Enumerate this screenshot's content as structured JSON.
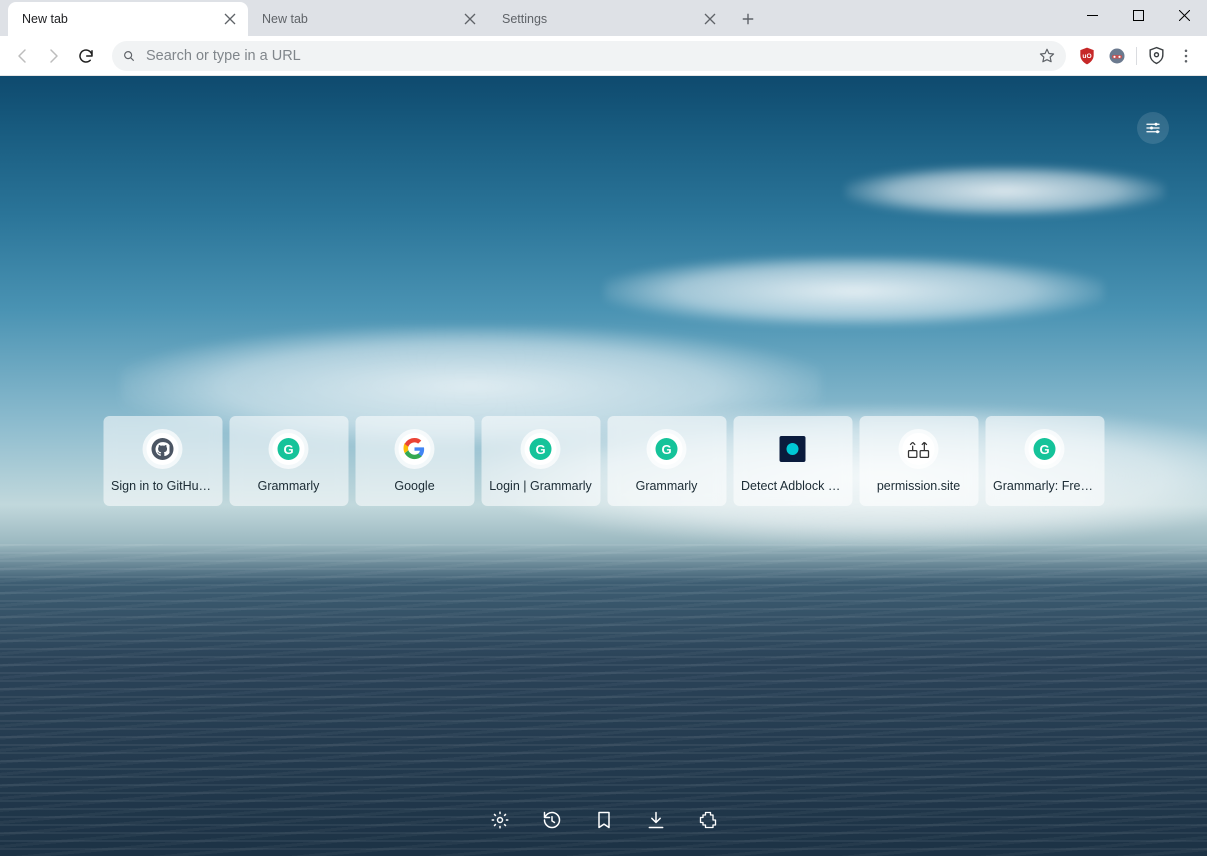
{
  "tabs": [
    {
      "title": "New tab",
      "active": true
    },
    {
      "title": "New tab",
      "active": false
    },
    {
      "title": "Settings",
      "active": false
    }
  ],
  "omnibox": {
    "placeholder": "Search or type in a URL"
  },
  "extensions": [
    "ublock",
    "avatar",
    "shield"
  ],
  "shortcuts": [
    {
      "label": "Sign in to GitHub...",
      "icon": "github"
    },
    {
      "label": "Grammarly",
      "icon": "grammarly"
    },
    {
      "label": "Google",
      "icon": "google"
    },
    {
      "label": "Login | Grammarly",
      "icon": "grammarly"
    },
    {
      "label": "Grammarly",
      "icon": "grammarly"
    },
    {
      "label": "Detect Adblock - ...",
      "icon": "detect"
    },
    {
      "label": "permission.site",
      "icon": "permission"
    },
    {
      "label": "Grammarly: Free ...",
      "icon": "grammarly"
    }
  ],
  "bottomButtons": [
    "settings",
    "history",
    "bookmarks",
    "downloads",
    "extensions"
  ]
}
